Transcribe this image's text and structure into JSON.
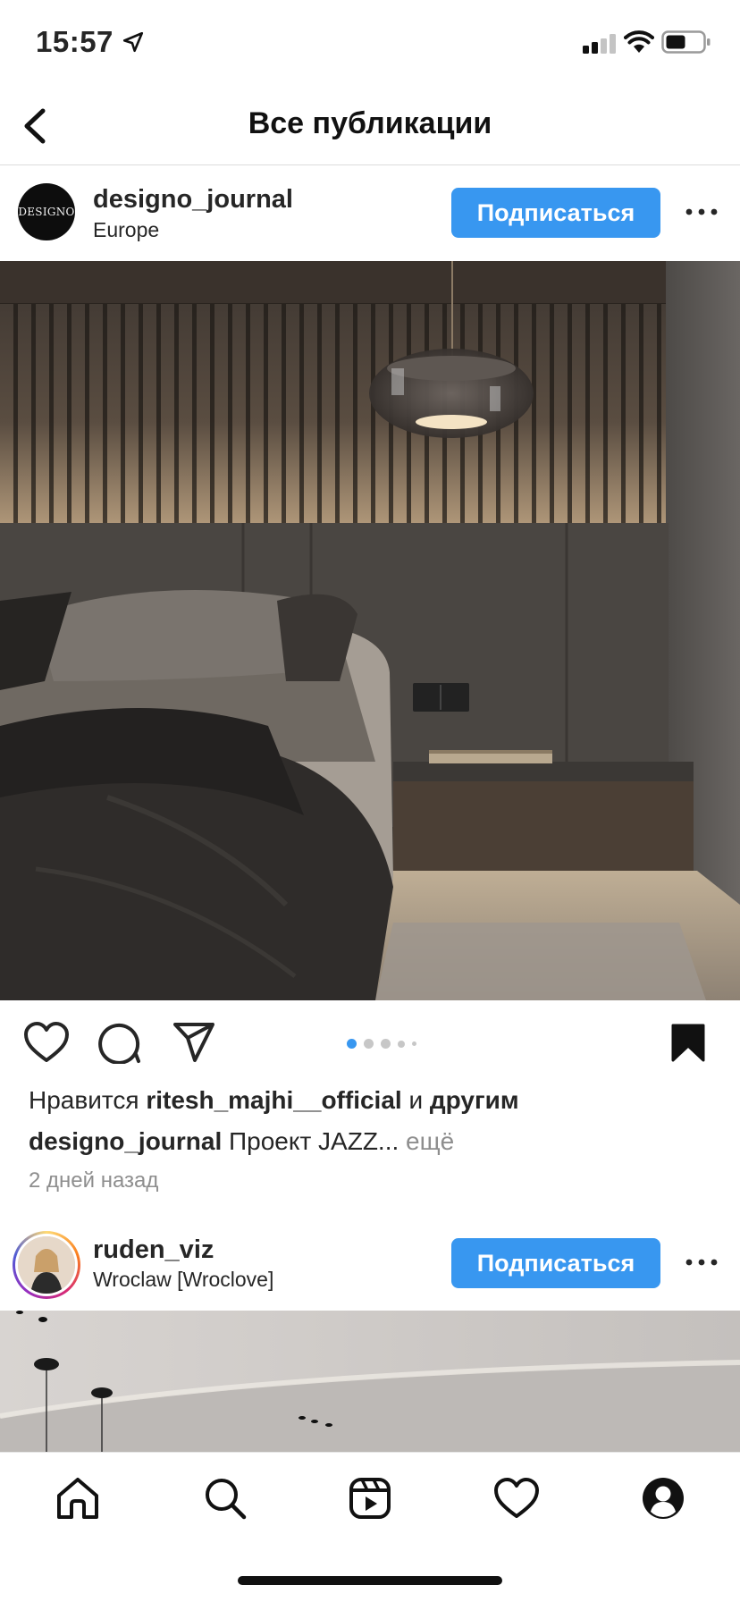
{
  "status_bar": {
    "time": "15:57"
  },
  "header": {
    "title": "Все публикации"
  },
  "posts": [
    {
      "username": "designo_journal",
      "location": "Europe",
      "avatar_text": "DESIGNO",
      "follow_label": "Подписаться",
      "carousel": {
        "count": 5,
        "active_index": 0
      },
      "likes": {
        "prefix": "Нравится",
        "user": "ritesh_majhi__official",
        "joiner": "и",
        "others": "другим"
      },
      "caption": {
        "user": "designo_journal",
        "text": "Проект JAZZ...",
        "more": "ещё"
      },
      "time": "2 дней назад"
    },
    {
      "username": "ruden_viz",
      "location": "Wroclaw [Wroclove]",
      "follow_label": "Подписаться"
    }
  ],
  "tabs": [
    "home",
    "search",
    "reels",
    "activity",
    "profile"
  ],
  "colors": {
    "accent": "#3897f0",
    "text": "#262626",
    "muted": "#8e8e8e"
  }
}
